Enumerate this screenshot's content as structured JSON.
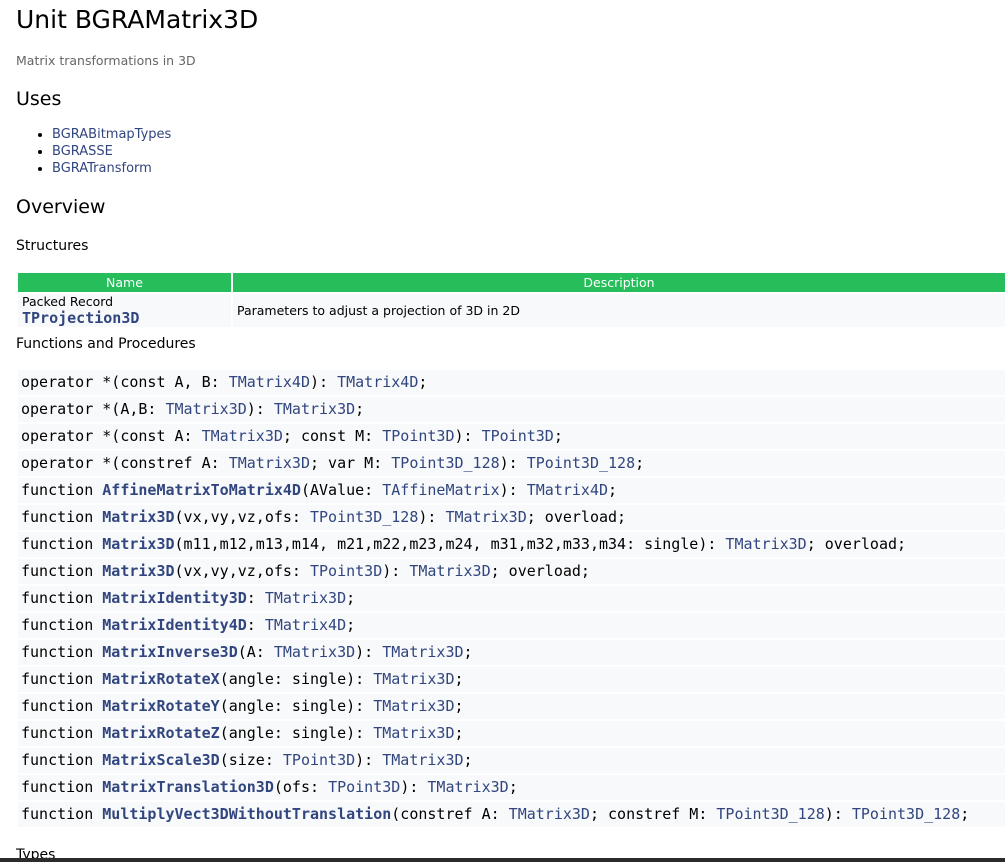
{
  "page": {
    "title": "Unit BGRAMatrix3D",
    "description": "Matrix transformations in 3D"
  },
  "uses": {
    "heading": "Uses",
    "items": [
      "BGRABitmapTypes",
      "BGRASSE",
      "BGRATransform"
    ]
  },
  "overview": {
    "heading": "Overview",
    "structures_heading": "Structures",
    "table": {
      "col_name": "Name",
      "col_description": "Description",
      "rows": [
        {
          "kind": "Packed Record",
          "name": "TProjection3D",
          "description": "Parameters to adjust a projection of 3D in 2D"
        }
      ]
    },
    "functions_heading": "Functions and Procedures",
    "functions": [
      [
        [
          "t",
          "operator *(const A, B: "
        ],
        [
          "a",
          "TMatrix4D"
        ],
        [
          "t",
          "): "
        ],
        [
          "a",
          "TMatrix4D"
        ],
        [
          "t",
          ";"
        ]
      ],
      [
        [
          "t",
          "operator *(A,B: "
        ],
        [
          "a",
          "TMatrix3D"
        ],
        [
          "t",
          "): "
        ],
        [
          "a",
          "TMatrix3D"
        ],
        [
          "t",
          ";"
        ]
      ],
      [
        [
          "t",
          "operator *(const A: "
        ],
        [
          "a",
          "TMatrix3D"
        ],
        [
          "t",
          "; const M: "
        ],
        [
          "a",
          "TPoint3D"
        ],
        [
          "t",
          "): "
        ],
        [
          "a",
          "TPoint3D"
        ],
        [
          "t",
          ";"
        ]
      ],
      [
        [
          "t",
          "operator *(constref A: "
        ],
        [
          "a",
          "TMatrix3D"
        ],
        [
          "t",
          "; var M: "
        ],
        [
          "a",
          "TPoint3D_128"
        ],
        [
          "t",
          "): "
        ],
        [
          "a",
          "TPoint3D_128"
        ],
        [
          "t",
          ";"
        ]
      ],
      [
        [
          "t",
          "function "
        ],
        [
          "n",
          "AffineMatrixToMatrix4D"
        ],
        [
          "t",
          "(AValue: "
        ],
        [
          "a",
          "TAffineMatrix"
        ],
        [
          "t",
          "): "
        ],
        [
          "a",
          "TMatrix4D"
        ],
        [
          "t",
          ";"
        ]
      ],
      [
        [
          "t",
          "function "
        ],
        [
          "n",
          "Matrix3D"
        ],
        [
          "t",
          "(vx,vy,vz,ofs: "
        ],
        [
          "a",
          "TPoint3D_128"
        ],
        [
          "t",
          "): "
        ],
        [
          "a",
          "TMatrix3D"
        ],
        [
          "t",
          "; overload;"
        ]
      ],
      [
        [
          "t",
          "function "
        ],
        [
          "n",
          "Matrix3D"
        ],
        [
          "t",
          "(m11,m12,m13,m14, m21,m22,m23,m24, m31,m32,m33,m34: single): "
        ],
        [
          "a",
          "TMatrix3D"
        ],
        [
          "t",
          "; overload;"
        ]
      ],
      [
        [
          "t",
          "function "
        ],
        [
          "n",
          "Matrix3D"
        ],
        [
          "t",
          "(vx,vy,vz,ofs: "
        ],
        [
          "a",
          "TPoint3D"
        ],
        [
          "t",
          "): "
        ],
        [
          "a",
          "TMatrix3D"
        ],
        [
          "t",
          "; overload;"
        ]
      ],
      [
        [
          "t",
          "function "
        ],
        [
          "n",
          "MatrixIdentity3D"
        ],
        [
          "t",
          ": "
        ],
        [
          "a",
          "TMatrix3D"
        ],
        [
          "t",
          ";"
        ]
      ],
      [
        [
          "t",
          "function "
        ],
        [
          "n",
          "MatrixIdentity4D"
        ],
        [
          "t",
          ": "
        ],
        [
          "a",
          "TMatrix4D"
        ],
        [
          "t",
          ";"
        ]
      ],
      [
        [
          "t",
          "function "
        ],
        [
          "n",
          "MatrixInverse3D"
        ],
        [
          "t",
          "(A: "
        ],
        [
          "a",
          "TMatrix3D"
        ],
        [
          "t",
          "): "
        ],
        [
          "a",
          "TMatrix3D"
        ],
        [
          "t",
          ";"
        ]
      ],
      [
        [
          "t",
          "function "
        ],
        [
          "n",
          "MatrixRotateX"
        ],
        [
          "t",
          "(angle: single): "
        ],
        [
          "a",
          "TMatrix3D"
        ],
        [
          "t",
          ";"
        ]
      ],
      [
        [
          "t",
          "function "
        ],
        [
          "n",
          "MatrixRotateY"
        ],
        [
          "t",
          "(angle: single): "
        ],
        [
          "a",
          "TMatrix3D"
        ],
        [
          "t",
          ";"
        ]
      ],
      [
        [
          "t",
          "function "
        ],
        [
          "n",
          "MatrixRotateZ"
        ],
        [
          "t",
          "(angle: single): "
        ],
        [
          "a",
          "TMatrix3D"
        ],
        [
          "t",
          ";"
        ]
      ],
      [
        [
          "t",
          "function "
        ],
        [
          "n",
          "MatrixScale3D"
        ],
        [
          "t",
          "(size: "
        ],
        [
          "a",
          "TPoint3D"
        ],
        [
          "t",
          "): "
        ],
        [
          "a",
          "TMatrix3D"
        ],
        [
          "t",
          ";"
        ]
      ],
      [
        [
          "t",
          "function "
        ],
        [
          "n",
          "MatrixTranslation3D"
        ],
        [
          "t",
          "(ofs: "
        ],
        [
          "a",
          "TPoint3D"
        ],
        [
          "t",
          "): "
        ],
        [
          "a",
          "TMatrix3D"
        ],
        [
          "t",
          ";"
        ]
      ],
      [
        [
          "t",
          "function "
        ],
        [
          "n",
          "MultiplyVect3DWithoutTranslation"
        ],
        [
          "t",
          "(constref A: "
        ],
        [
          "a",
          "TMatrix3D"
        ],
        [
          "t",
          "; constref M: "
        ],
        [
          "a",
          "TPoint3D_128"
        ],
        [
          "t",
          "): "
        ],
        [
          "a",
          "TPoint3D_128"
        ],
        [
          "t",
          ";"
        ]
      ]
    ],
    "types_heading": "Types"
  },
  "colors": {
    "link": "#31457f",
    "table_header_bg": "#25be5b",
    "row_bg": "#f8f9fa",
    "muted_text": "#666666"
  }
}
